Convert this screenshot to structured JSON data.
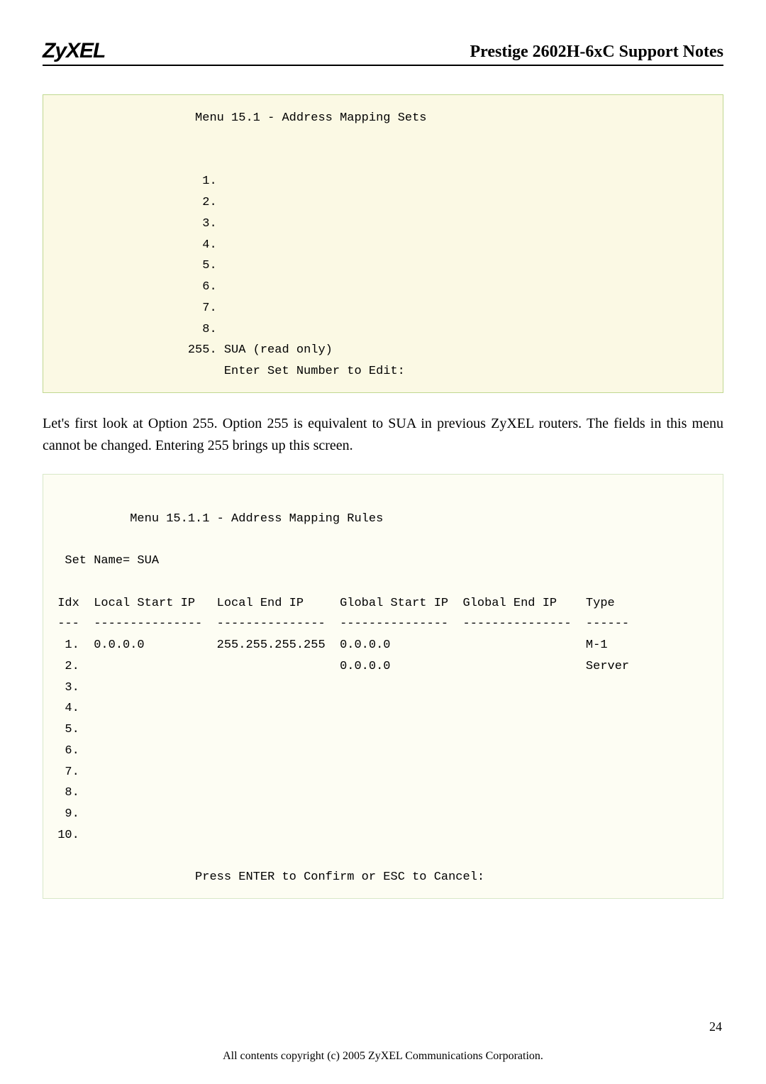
{
  "header": {
    "logo": "ZyXEL",
    "doc_title": "Prestige 2602H-6xC Support Notes"
  },
  "terminal1": {
    "title": "Menu 15.1 - Address Mapping Sets",
    "items": [
      "1.",
      "2.",
      "3.",
      "4.",
      "5.",
      "6.",
      "7.",
      "8."
    ],
    "line255": "255. SUA (read only)",
    "prompt": "Enter Set Number to Edit:"
  },
  "paragraph1": "Let's first look at Option 255. Option 255 is equivalent to SUA in previous ZyXEL routers. The fields in this menu cannot be changed. Entering 255 brings up this screen.",
  "terminal2": {
    "title": "Menu 15.1.1 - Address Mapping Rules",
    "set_name": "Set Name= SUA",
    "header_row": "Idx  Local Start IP   Local End IP     Global Start IP  Global End IP    Type",
    "divider_row": "---  ---------------  ---------------  ---------------  ---------------  ------",
    "row1": " 1.  0.0.0.0          255.255.255.255  0.0.0.0                           M-1",
    "row2": " 2.                                    0.0.0.0                           Server",
    "rows_empty": [
      " 3.",
      " 4.",
      " 5.",
      " 6.",
      " 7.",
      " 8.",
      " 9.",
      "10."
    ],
    "prompt": "Press ENTER to Confirm or ESC to Cancel:"
  },
  "footer": {
    "copyright": "All contents copyright (c) 2005 ZyXEL Communications Corporation.",
    "page_number": "24"
  }
}
